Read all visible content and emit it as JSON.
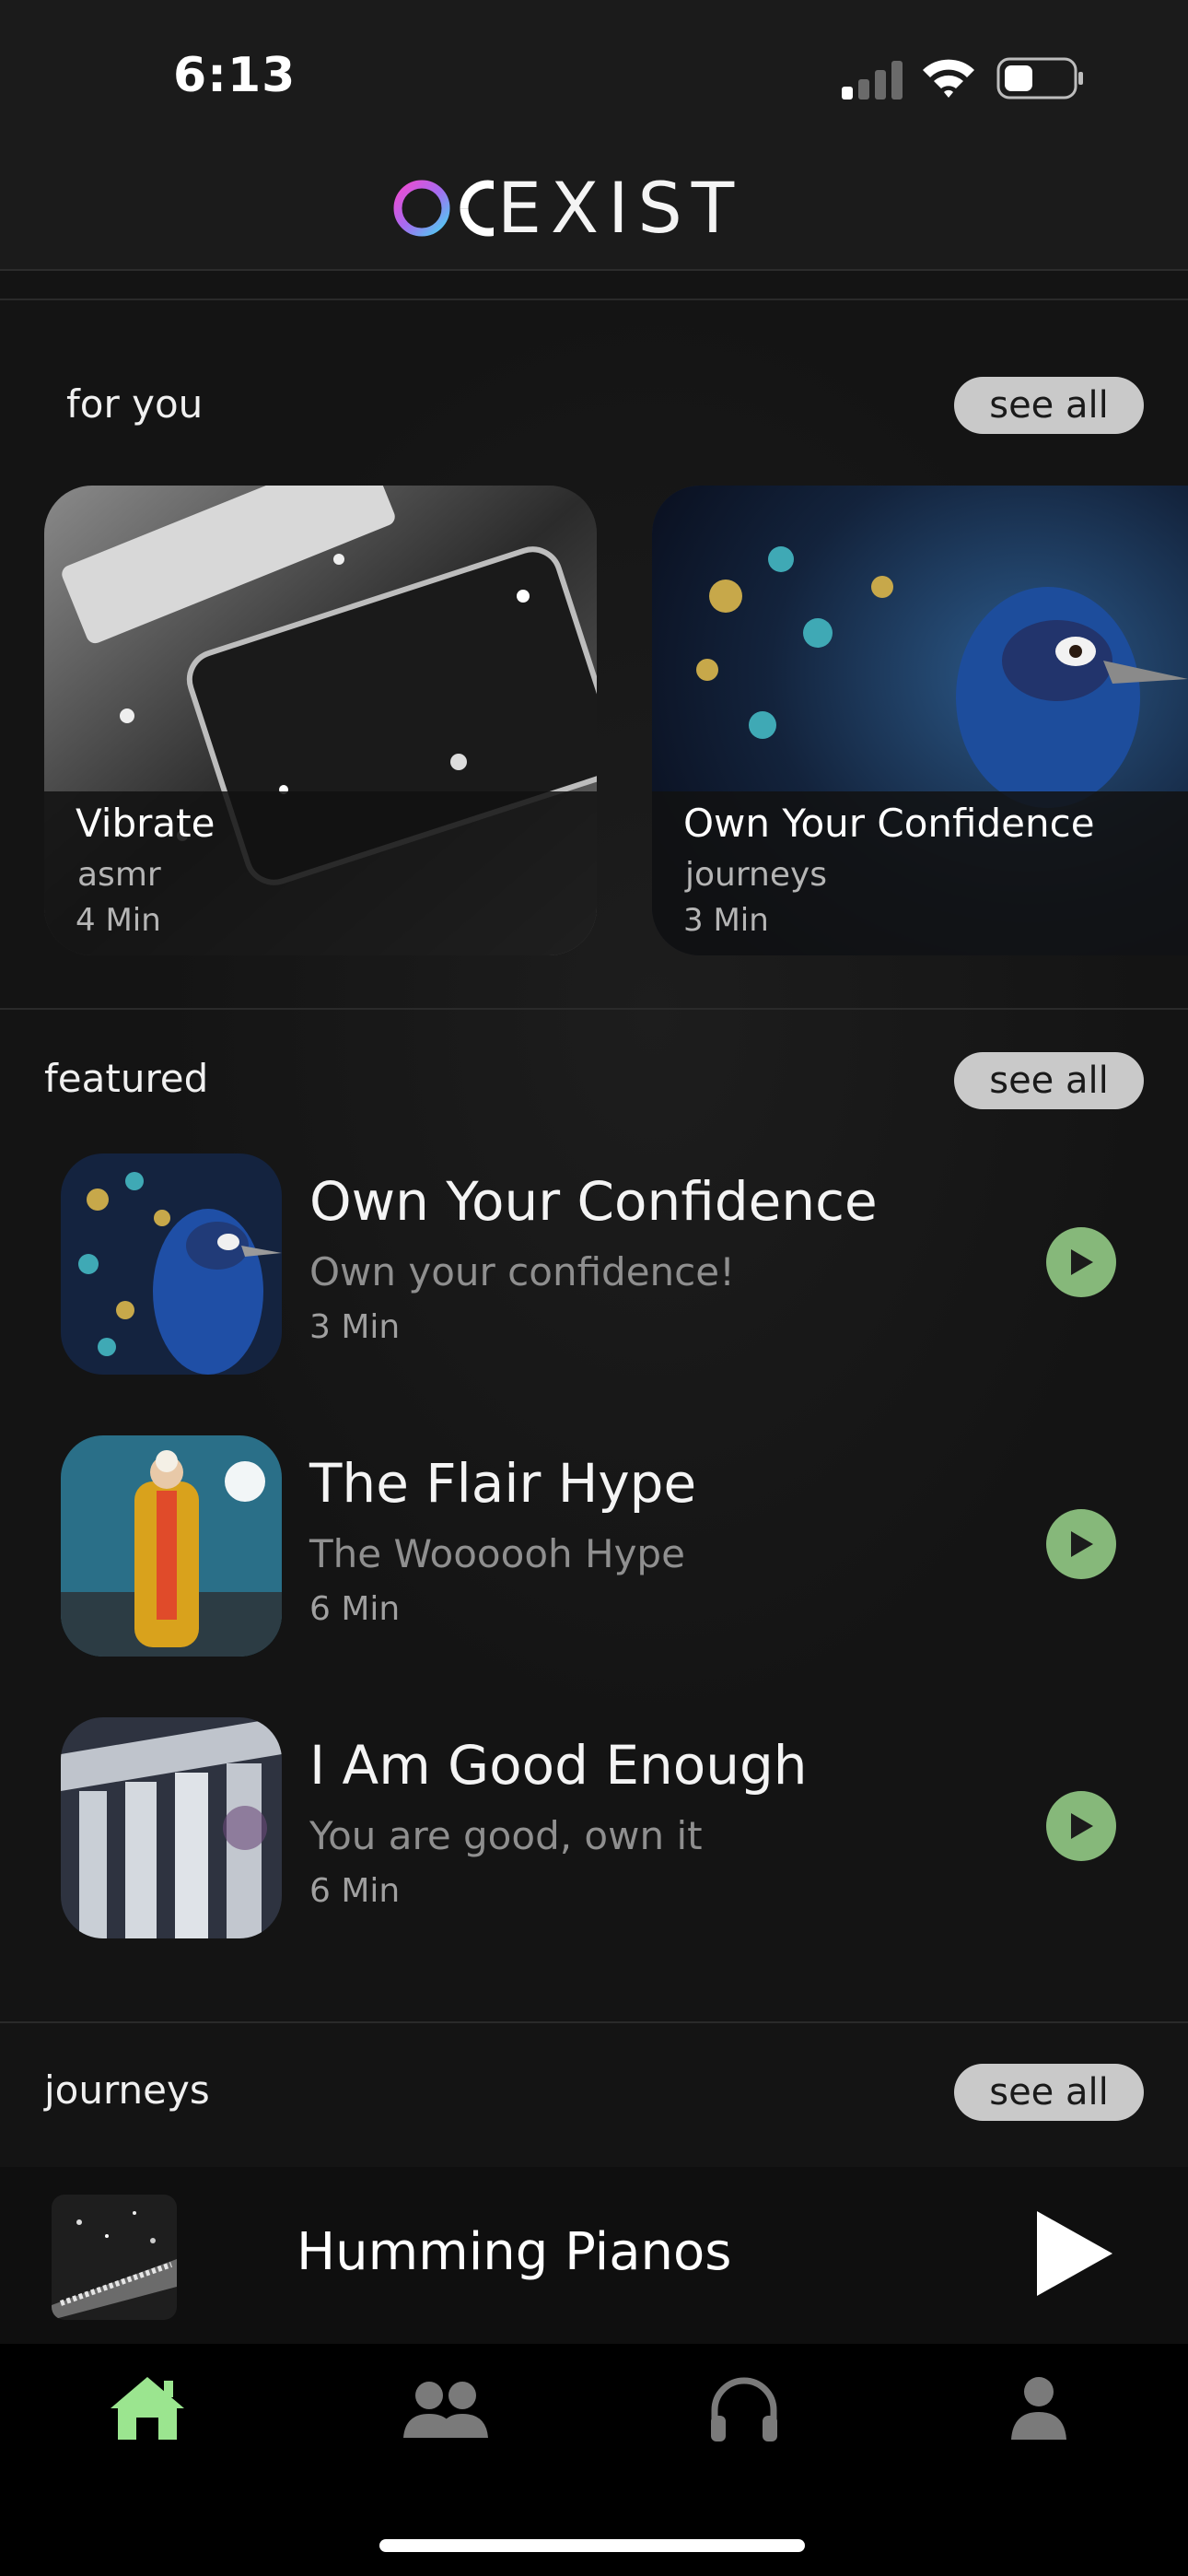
{
  "status": {
    "time": "6:13"
  },
  "app": {
    "logo_text": "EXIST"
  },
  "for_you": {
    "title": "for you",
    "see_all": "see all",
    "cards": [
      {
        "title": "Vibrate",
        "category": "asmr",
        "duration": "4 Min"
      },
      {
        "title": "Own Your Confidence",
        "category": "journeys",
        "duration": "3 Min"
      }
    ]
  },
  "featured": {
    "title": "featured",
    "see_all": "see all",
    "items": [
      {
        "title": "Own Your Confidence",
        "subtitle": "Own your confidence!",
        "duration": "3 Min"
      },
      {
        "title": "The Flair Hype",
        "subtitle": "The Woooooh Hype",
        "duration": "6 Min"
      },
      {
        "title": "I Am Good Enough",
        "subtitle": "You are good, own it",
        "duration": "6 Min"
      }
    ]
  },
  "journeys": {
    "title": "journeys",
    "see_all": "see all"
  },
  "now_playing": {
    "title": "Humming Pianos"
  },
  "tabs": [
    {
      "icon": "home-icon",
      "active": true
    },
    {
      "icon": "community-icon",
      "active": false
    },
    {
      "icon": "headphones-icon",
      "active": false
    },
    {
      "icon": "profile-icon",
      "active": false
    }
  ],
  "colors": {
    "accent": "#86b87a",
    "active_tab": "#9be58f",
    "background": "#141414",
    "pill": "#c9c9c9"
  }
}
